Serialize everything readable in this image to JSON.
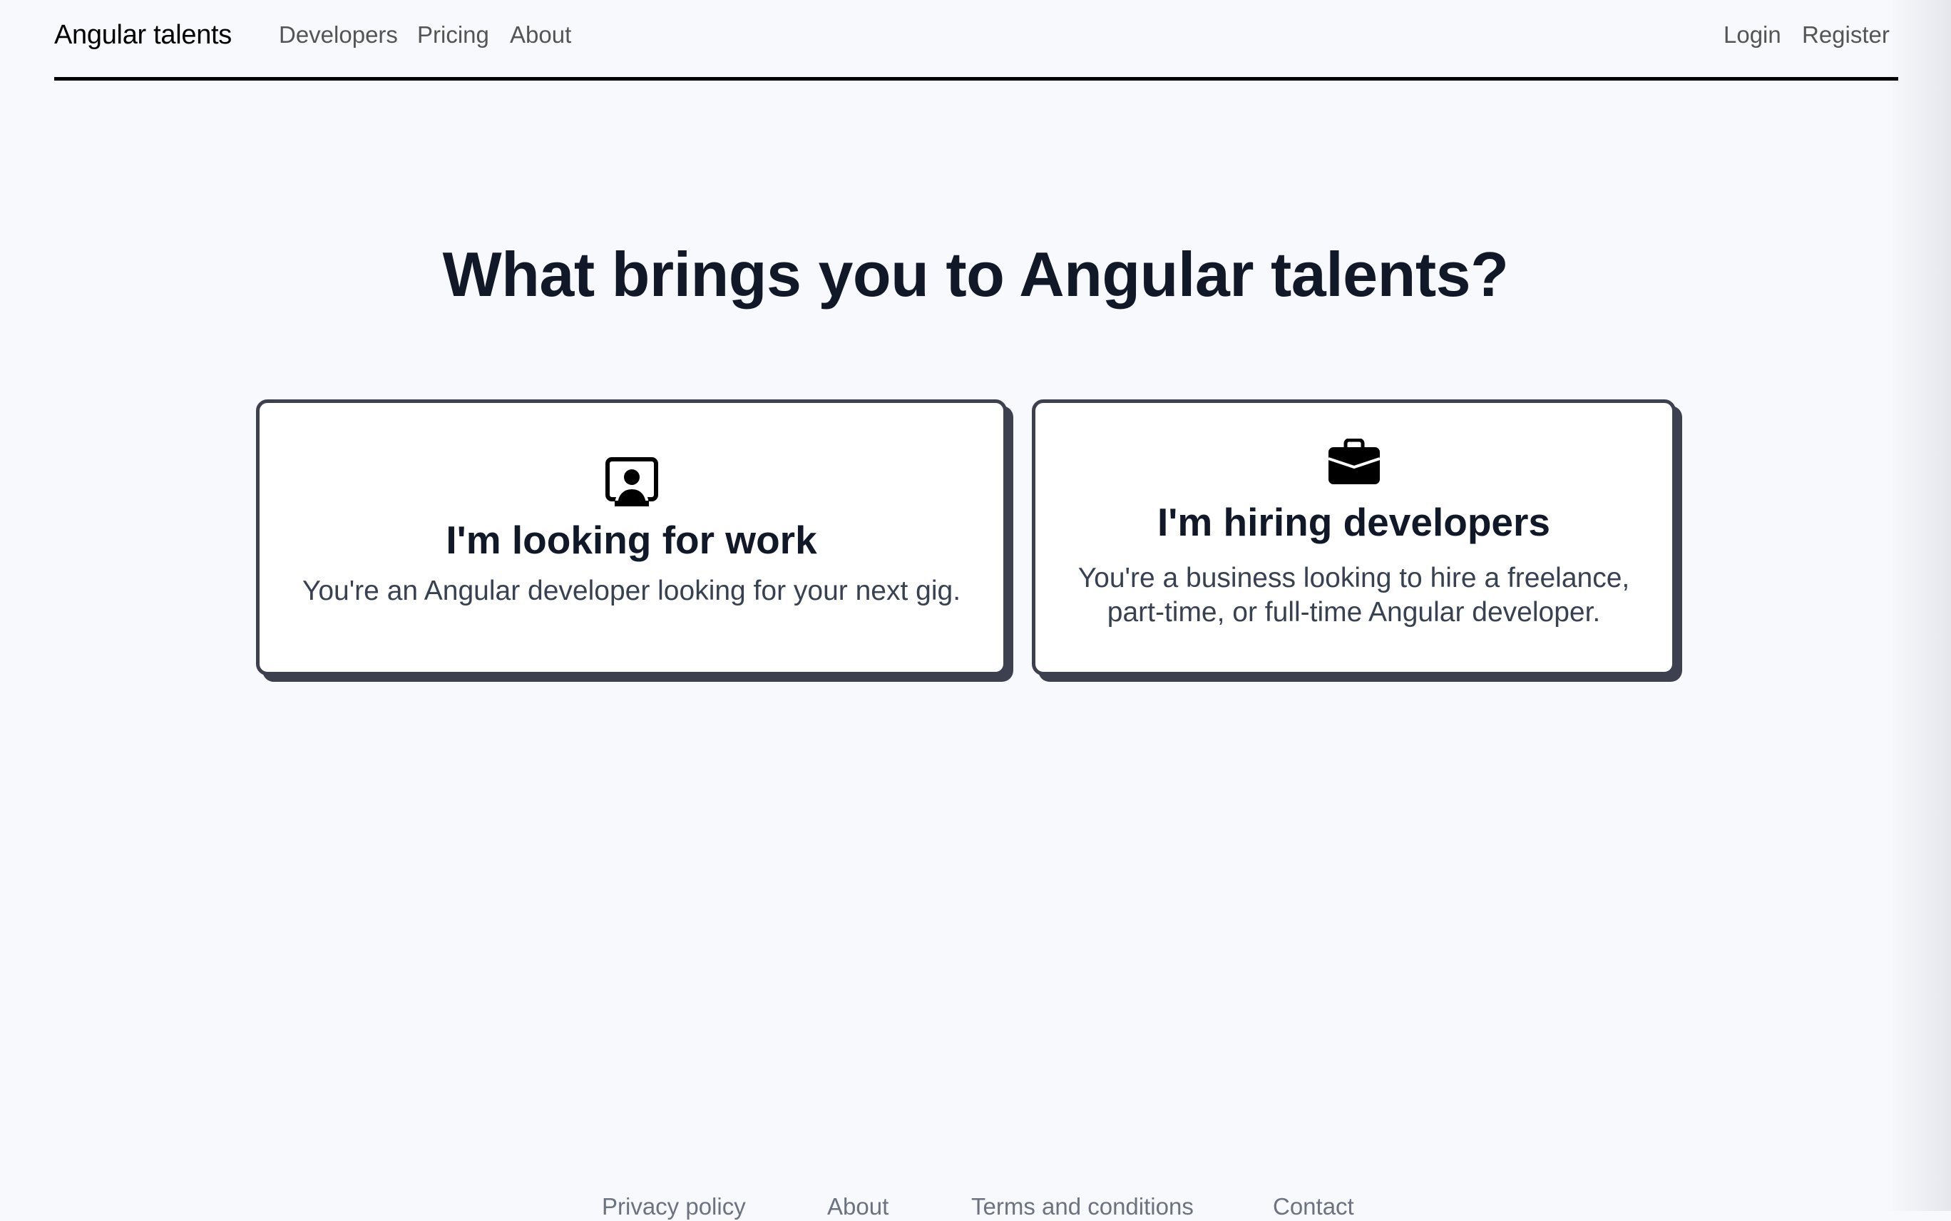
{
  "header": {
    "brand": "Angular talents",
    "nav": [
      {
        "label": "Developers"
      },
      {
        "label": "Pricing"
      },
      {
        "label": "About"
      }
    ],
    "auth": {
      "login": "Login",
      "register": "Register"
    }
  },
  "main": {
    "title": "What brings you to Angular talents?",
    "cards": [
      {
        "icon": "person-video-icon",
        "heading": "I'm looking for work",
        "description": "You're an Angular developer looking for your next gig."
      },
      {
        "icon": "briefcase-icon",
        "heading": "I'm hiring developers",
        "description": "You're a business looking to hire a freelance, part-time, or full-time Angular developer."
      }
    ]
  },
  "footer": {
    "links": [
      {
        "label": "Privacy policy"
      },
      {
        "label": "About"
      },
      {
        "label": "Terms and conditions"
      },
      {
        "label": "Contact"
      }
    ]
  },
  "colors": {
    "background": "#f8f9fc",
    "heading": "#111827",
    "body_text": "#374151",
    "nav_text": "#555555",
    "footer_text": "#6b7280",
    "card_border": "#3d414f",
    "header_rule": "#000000"
  }
}
